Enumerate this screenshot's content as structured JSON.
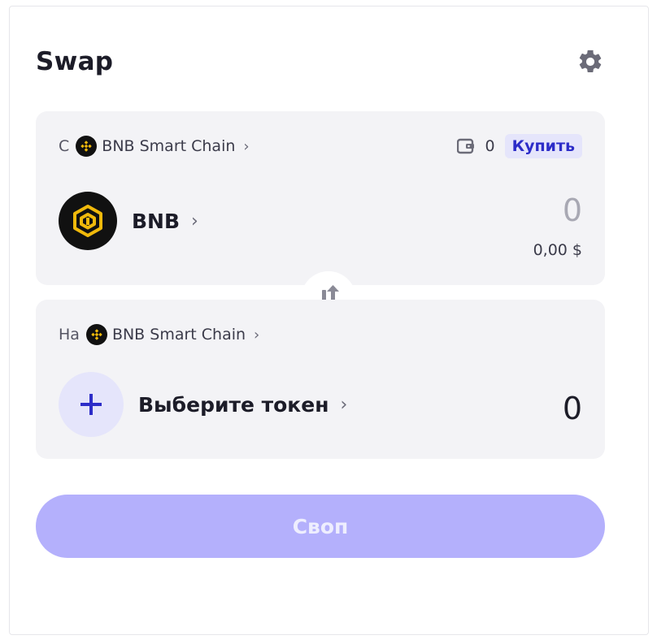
{
  "header": {
    "title": "Swap",
    "settings_icon": "gear-icon"
  },
  "from": {
    "prefix": "С",
    "chain": "BNB Smart Chain",
    "balance": "0",
    "buy_label": "Купить",
    "token": "BNB",
    "amount": "0",
    "usd_value": "0,00 $"
  },
  "to": {
    "prefix": "На",
    "chain": "BNB Smart Chain",
    "select_label": "Выберите токен",
    "amount": "0"
  },
  "submit_label": "Своп",
  "colors": {
    "accent": "#2d2dc8",
    "button_disabled": "#b4b0fc",
    "panel_bg": "#f3f3f6",
    "bnb_yellow": "#f0b90b"
  }
}
